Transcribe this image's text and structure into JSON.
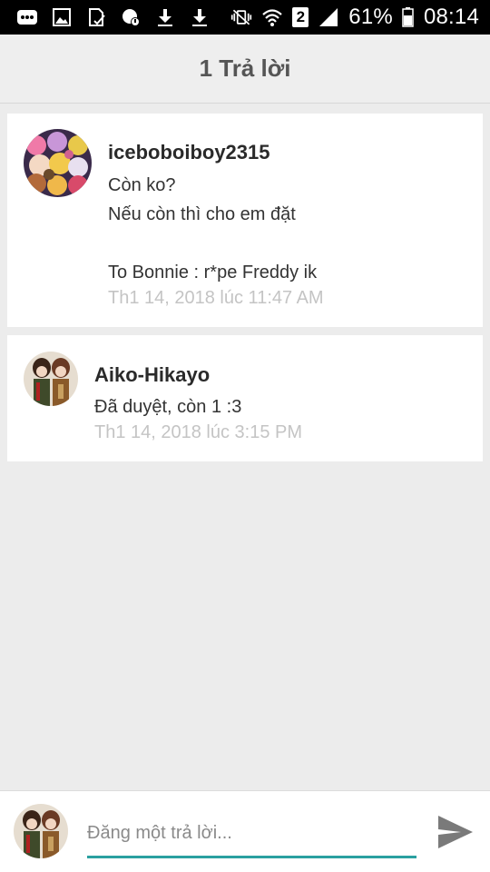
{
  "status_bar": {
    "icons": [
      "message-icon",
      "image-icon",
      "checked-file-icon",
      "blocked-icon",
      "download-icon",
      "download-icon",
      "vibrate-mute-icon",
      "wifi-icon",
      "sim2-icon",
      "signal-icon",
      "battery-icon"
    ],
    "sim_label": "2",
    "battery": "61%",
    "time": "08:14"
  },
  "header": {
    "title": "1 Trả lời"
  },
  "comments": [
    {
      "username": "iceboboiboy2315",
      "body": "Còn ko?\nNếu còn thì cho em đặt\n\nTo Bonnie : r*pe Freddy ik",
      "timestamp": "Th1 14, 2018 lúc 11:47 AM"
    },
    {
      "username": "Aiko-Hikayo",
      "body": "Đã duyệt, còn 1 :3",
      "timestamp": "Th1 14, 2018 lúc 3:15 PM"
    }
  ],
  "reply": {
    "placeholder": "Đăng một trả lời..."
  },
  "colors": {
    "accent": "#2aa0a0",
    "background": "#ececec",
    "status_bar": "#000000",
    "timestamp": "#c4c4c4"
  }
}
